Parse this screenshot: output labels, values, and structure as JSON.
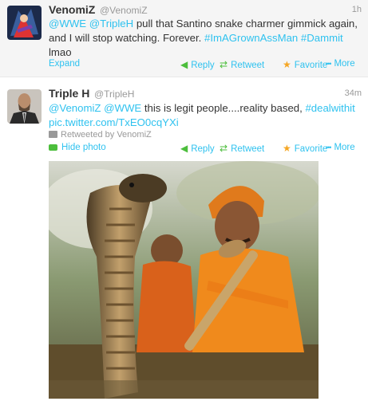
{
  "tweets": [
    {
      "fullname": "VenomiZ",
      "screen_name": "@VenomiZ",
      "time": "1h",
      "text": [
        {
          "t": "@WWE",
          "k": "link"
        },
        {
          "t": " ",
          "k": "plain"
        },
        {
          "t": "@TripleH",
          "k": "link"
        },
        {
          "t": " pull that Santino snake charmer gimmick again, and I will stop watching. Forever. ",
          "k": "plain"
        },
        {
          "t": "#ImAGrownAssMan",
          "k": "tag"
        },
        {
          "t": " ",
          "k": "plain"
        },
        {
          "t": "#Dammit",
          "k": "tag"
        },
        {
          "t": " lmao",
          "k": "plain"
        }
      ],
      "expand_label": "Expand",
      "actions": {
        "reply": "Reply",
        "retweet": "Retweet",
        "favorite": "Favorite",
        "more": "More"
      }
    },
    {
      "fullname": "Triple H",
      "screen_name": "@TripleH",
      "time": "34m",
      "text": [
        {
          "t": "@VenomiZ",
          "k": "link"
        },
        {
          "t": " ",
          "k": "plain"
        },
        {
          "t": "@WWE",
          "k": "link"
        },
        {
          "t": "  this is legit people....reality based, ",
          "k": "plain"
        },
        {
          "t": "#dealwithit",
          "k": "tag"
        },
        {
          "t": " ",
          "k": "plain"
        },
        {
          "t": "pic.twitter.com/TxEO0cqYXi",
          "k": "link"
        }
      ],
      "retweeted_by": "Retweeted by VenomiZ",
      "hide_photo_label": "Hide photo",
      "actions": {
        "reply": "Reply",
        "retweet": "Retweet",
        "favorite": "Favorite",
        "more": "More"
      }
    }
  ],
  "icons": {
    "reply": "reply-arrow-icon",
    "retweet": "retweet-icon",
    "favorite": "star-icon",
    "more": "more-dots-icon",
    "photo": "photo-icon",
    "retweeted": "retweeted-icon"
  },
  "colors": {
    "link": "#2fc2ef",
    "favorite_star": "#f5a623",
    "retweet_green": "#4cbe3c"
  }
}
